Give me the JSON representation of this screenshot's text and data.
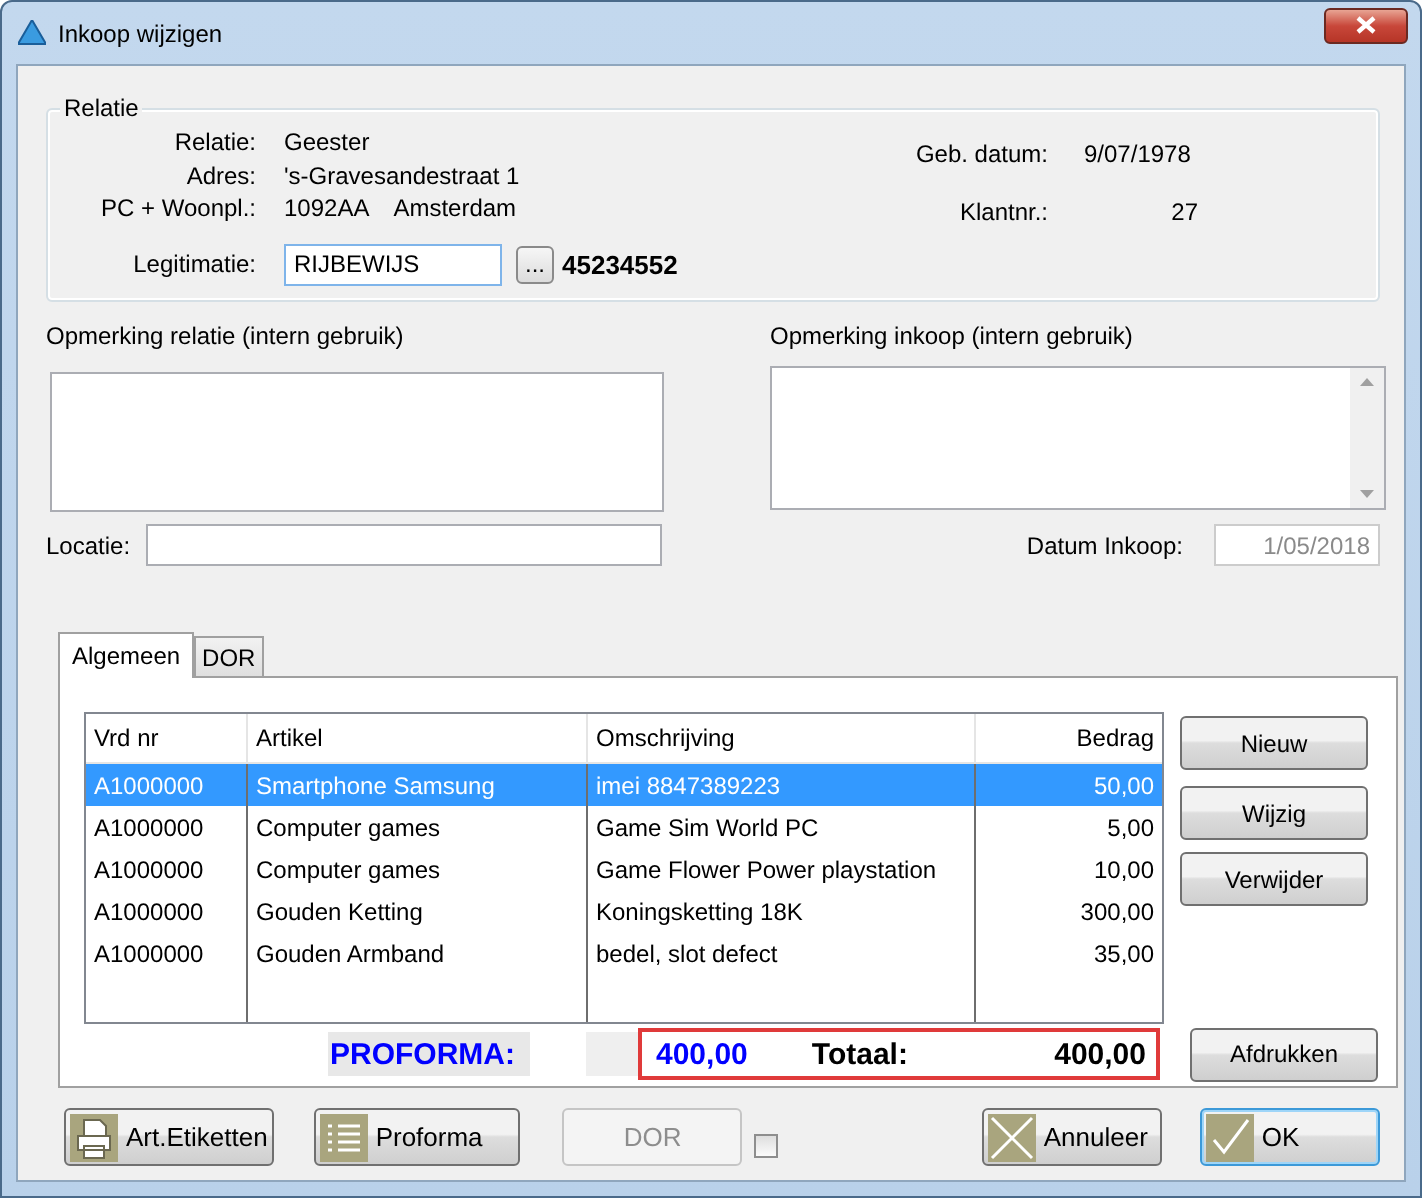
{
  "window": {
    "title": "Inkoop wijzigen"
  },
  "relatie": {
    "legend": "Relatie",
    "left": [
      {
        "label": "Relatie:",
        "values": [
          "Geester"
        ]
      },
      {
        "label": "Adres:",
        "values": [
          "'s-Gravesandestraat 1"
        ]
      },
      {
        "label": "PC + Woonpl.:",
        "values": [
          "1092AA",
          "Amsterdam"
        ]
      }
    ],
    "legitimatie": {
      "label": "Legitimatie:",
      "value": "RIJBEWIJS",
      "browse": "...",
      "number": "45234552"
    },
    "right": [
      {
        "label": "Geb. datum:",
        "value": "9/07/1978"
      },
      {
        "label": "Klantnr.:",
        "value": "27"
      }
    ]
  },
  "remarks": {
    "relatie_label": "Opmerking relatie (intern gebruik)",
    "inkoop_label": "Opmerking inkoop (intern gebruik)"
  },
  "locatie": {
    "label": "Locatie:"
  },
  "datum_inkoop": {
    "label": "Datum Inkoop:",
    "value": "1/05/2018"
  },
  "tabs": [
    {
      "label": "Algemeen",
      "selected": true
    },
    {
      "label": "DOR",
      "selected": false
    }
  ],
  "table": {
    "columns": [
      "Vrd nr",
      "Artikel",
      "Omschrijving",
      "Bedrag"
    ],
    "rows": [
      {
        "cells": [
          "A1000000",
          "Smartphone Samsung",
          "imei 8847389223",
          "50,00"
        ],
        "selected": true
      },
      {
        "cells": [
          "A1000000",
          "Computer games",
          "Game Sim World PC",
          "5,00"
        ],
        "selected": false
      },
      {
        "cells": [
          "A1000000",
          "Computer games",
          "Game Flower Power playstation",
          "10,00"
        ],
        "selected": false
      },
      {
        "cells": [
          "A1000000",
          "Gouden Ketting",
          "Koningsketting 18K",
          "300,00"
        ],
        "selected": false
      },
      {
        "cells": [
          "A1000000",
          "Gouden Armband",
          "bedel, slot defect",
          "35,00"
        ],
        "selected": false
      }
    ]
  },
  "side_buttons": [
    "Nieuw",
    "Wijzig",
    "Verwijder"
  ],
  "print_button": "Afdrukken",
  "totals": {
    "proforma_label": "PROFORMA:",
    "proforma_value": "400,00",
    "total_label": "Totaal:",
    "total_value": "400,00"
  },
  "footer": {
    "buttons": [
      {
        "label": "Art.Etiketten",
        "kind": "print",
        "disabled": false
      },
      {
        "label": "Proforma",
        "kind": "list",
        "disabled": false
      },
      {
        "label": "DOR",
        "kind": "plain",
        "disabled": true
      },
      {
        "label": "Annuleer",
        "kind": "cancel",
        "disabled": false
      },
      {
        "label": "OK",
        "kind": "ok",
        "disabled": false
      }
    ],
    "checkbox": {
      "checked": false
    }
  }
}
